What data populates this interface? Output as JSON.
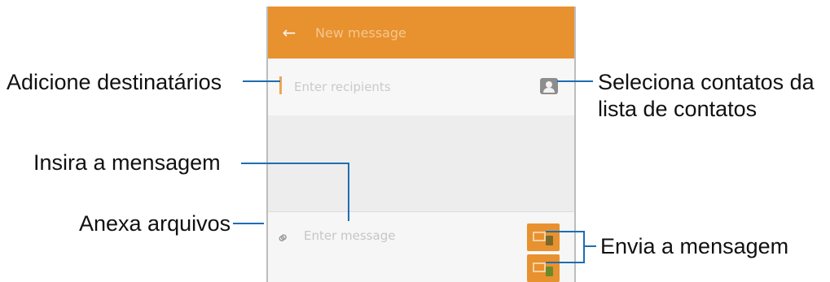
{
  "phone": {
    "title": "New message",
    "recipient_placeholder": "Enter recipients",
    "compose_placeholder": "Enter message"
  },
  "callouts": {
    "add_recipients": "Adicione destinatários",
    "select_contacts_line1": "Seleciona contatos da",
    "select_contacts_line2": "lista de contatos",
    "enter_message": "Insira a mensagem",
    "attach_files": "Anexa arquivos",
    "send_message": "Envia a mensagem"
  },
  "colors": {
    "appbar": "#e8912f",
    "callout_line": "#1e6db3"
  }
}
